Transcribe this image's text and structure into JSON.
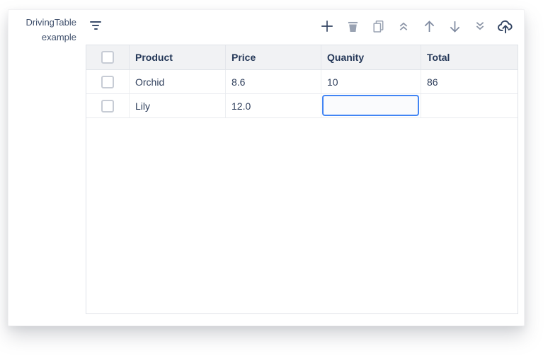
{
  "app": {
    "title": "DrivingTable example"
  },
  "toolbar": {
    "filter_icon": "filter-icon",
    "buttons": [
      {
        "name": "add",
        "icon": "plus-icon"
      },
      {
        "name": "remove",
        "icon": "trash-icon"
      },
      {
        "name": "copy",
        "icon": "copy-icon"
      },
      {
        "name": "move-top",
        "icon": "angle-double-up-icon"
      },
      {
        "name": "move-up",
        "icon": "arrow-up-icon"
      },
      {
        "name": "move-down",
        "icon": "arrow-down-icon"
      },
      {
        "name": "move-bottom",
        "icon": "angle-double-down-icon"
      },
      {
        "name": "upload",
        "icon": "cloud-upload-icon"
      }
    ]
  },
  "table": {
    "columns": [
      "Product",
      "Price",
      "Quanity",
      "Total"
    ],
    "rows": [
      {
        "checked": false,
        "product": "Orchid",
        "price": "8.6",
        "quantity": "10",
        "total": "86"
      },
      {
        "checked": false,
        "product": "Lily",
        "price": "12.0",
        "quantity": "",
        "total": ""
      }
    ],
    "selection": {
      "row_index": 1,
      "column": "Quanity"
    }
  },
  "colors": {
    "accent_blue": "#4285F4",
    "header_bg": "#F1F2F4",
    "header_text": "#253858",
    "cell_text": "#2F3F5C",
    "title_text": "#42526E",
    "icon_gray": "#99A2B2",
    "icon_dark": "#344563",
    "grid_border": "#DFE2E8"
  }
}
